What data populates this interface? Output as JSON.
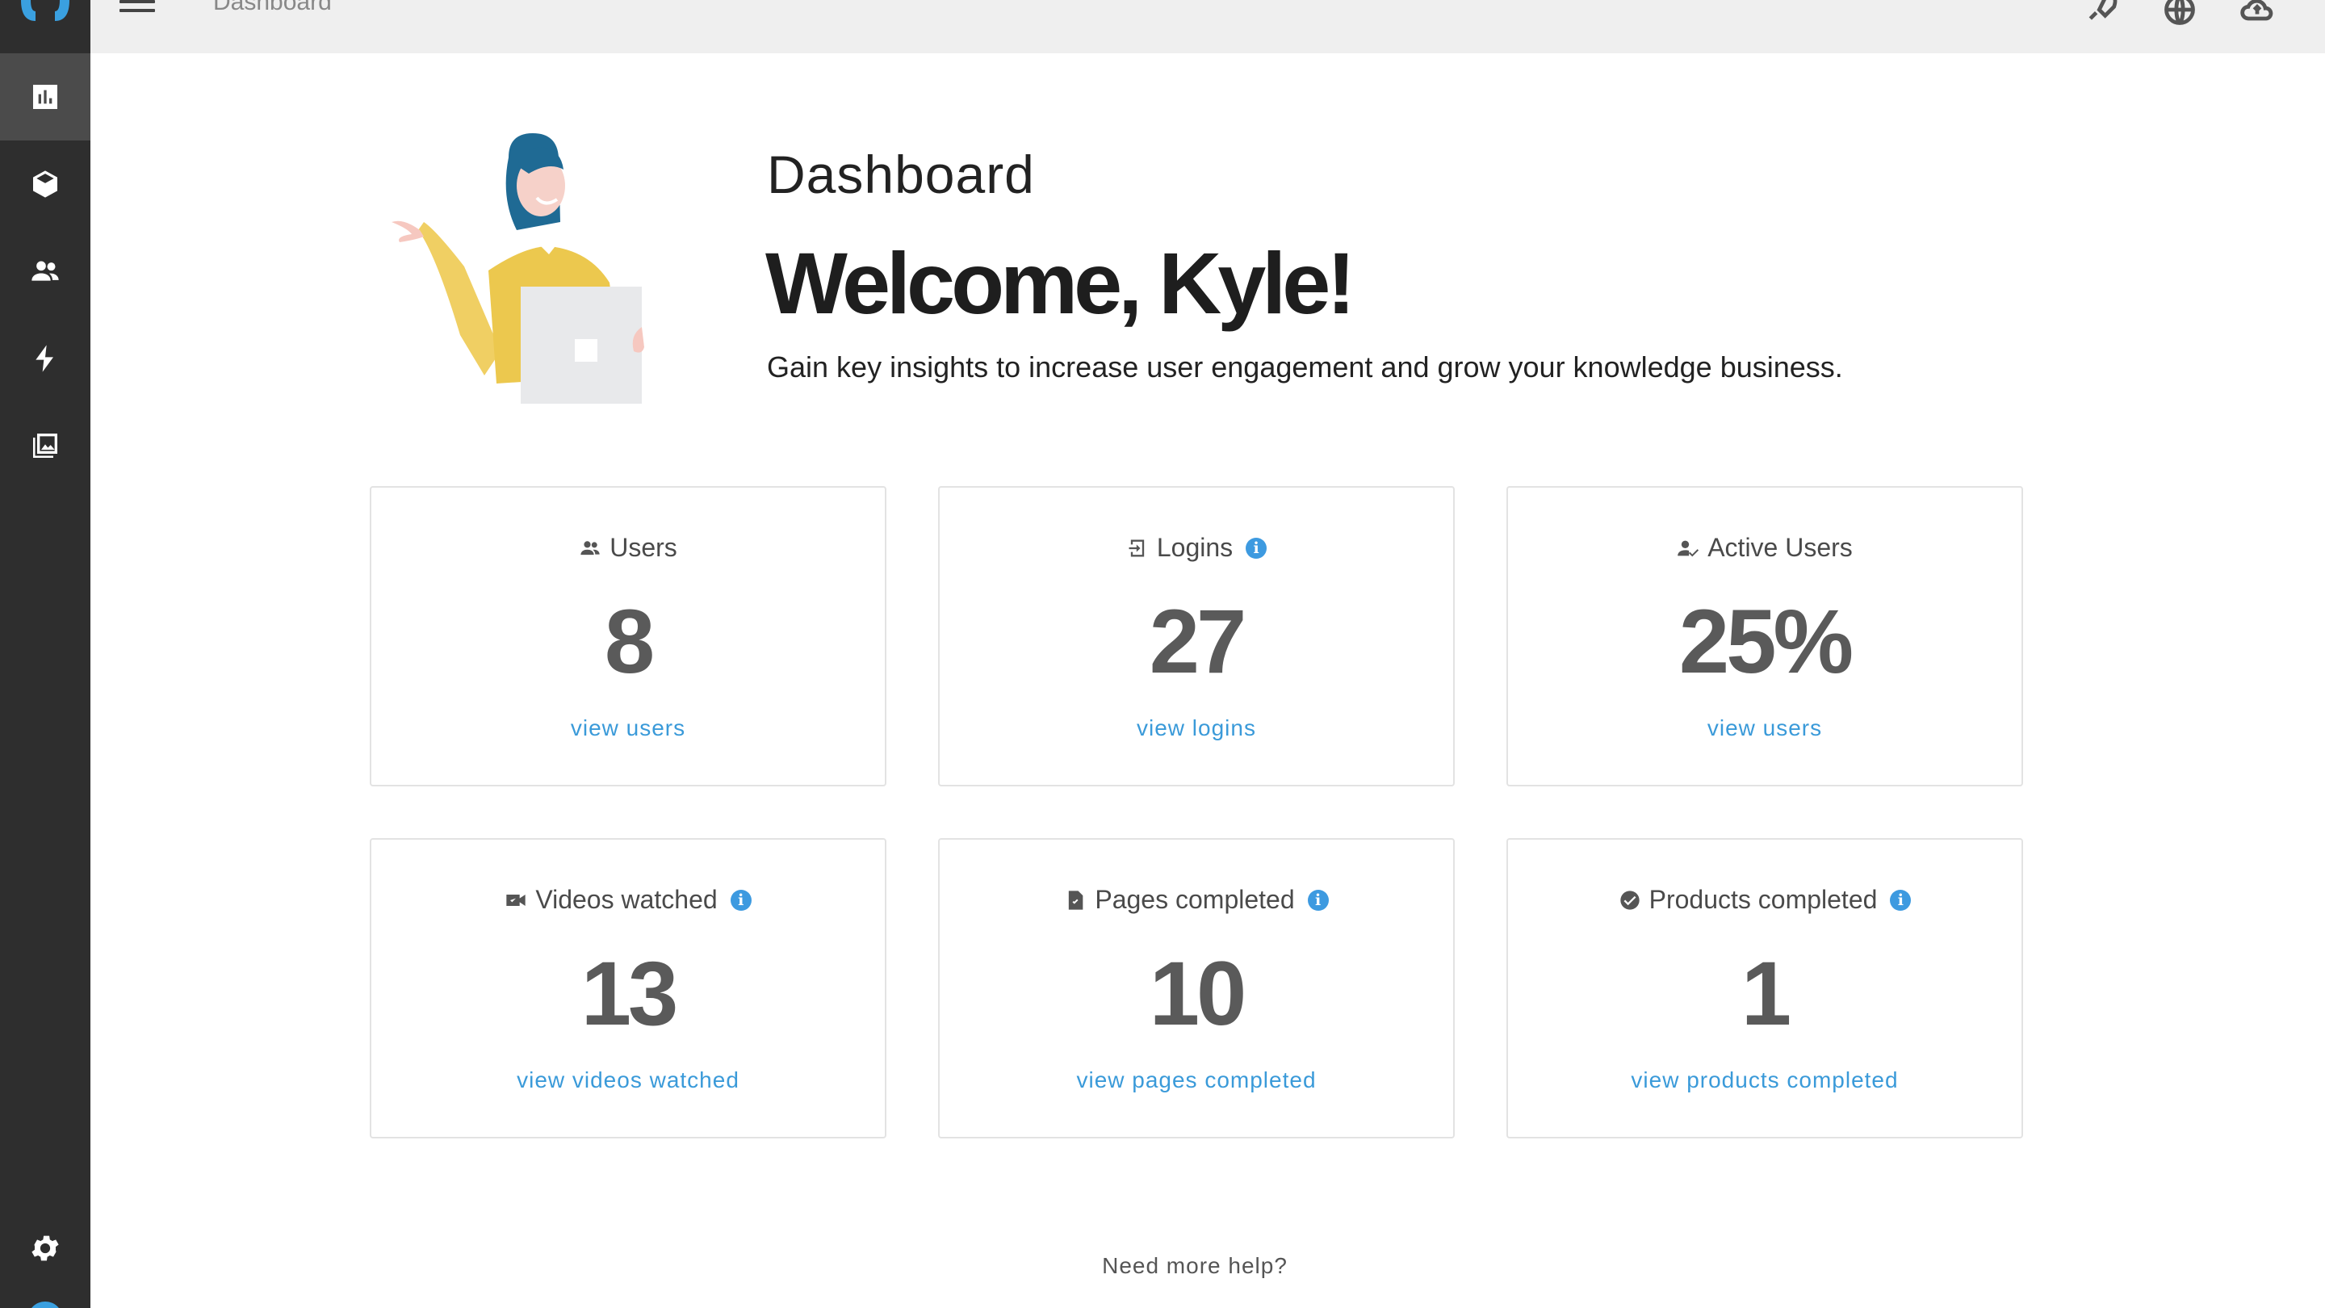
{
  "topbar": {
    "breadcrumb": "Dashboard"
  },
  "hero": {
    "subtitle": "Dashboard",
    "title": "Welcome, Kyle!",
    "description": "Gain key insights to increase user engagement and grow your knowledge business."
  },
  "cards": [
    {
      "label": "Users",
      "value": "8",
      "link": "view users"
    },
    {
      "label": "Logins",
      "value": "27",
      "link": "view logins"
    },
    {
      "label": "Active Users",
      "value": "25%",
      "link": "view users"
    },
    {
      "label": "Videos watched",
      "value": "13",
      "link": "view videos watched"
    },
    {
      "label": "Pages completed",
      "value": "10",
      "link": "view pages completed"
    },
    {
      "label": "Products completed",
      "value": "1",
      "link": "view products completed"
    }
  ],
  "footer": {
    "help": "Need more help?"
  },
  "colors": {
    "sidebar": "#2e2e2e",
    "accent": "#3a9ad9",
    "value": "#5a5a5a"
  }
}
